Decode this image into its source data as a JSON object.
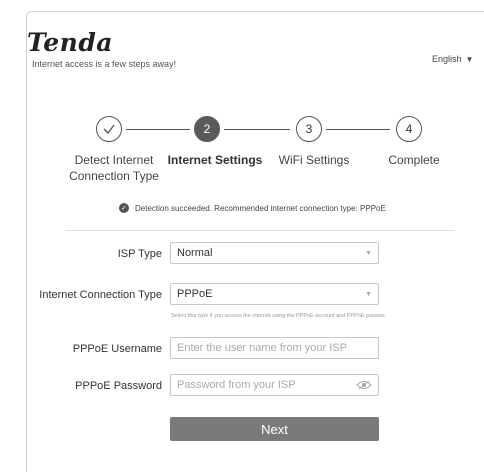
{
  "brand": {
    "logo": "Tenda",
    "tagline": "Internet access is a few steps away!"
  },
  "language": {
    "label": "English"
  },
  "steps": [
    {
      "number": "",
      "label": "Detect Internet Connection Type",
      "state": "done"
    },
    {
      "number": "2",
      "label": "Internet Settings",
      "state": "active"
    },
    {
      "number": "3",
      "label": "WiFi Settings",
      "state": "pending"
    },
    {
      "number": "4",
      "label": "Complete",
      "state": "pending"
    }
  ],
  "status": {
    "text": "Detection succeeded. Recommended internet connection type: PPPoE"
  },
  "form": {
    "isp_type": {
      "label": "ISP Type",
      "value": "Normal"
    },
    "connection_type": {
      "label": "Internet Connection Type",
      "value": "PPPoE",
      "hint": "Select this type if you access the internet using the PPPoE account and PPPoE passwo"
    },
    "username": {
      "label": "PPPoE Username",
      "placeholder": "Enter the user name from your ISP"
    },
    "password": {
      "label": "PPPoE Password",
      "placeholder": "Password from your ISP"
    }
  },
  "next_button": {
    "label": "Next"
  },
  "colors": {
    "accent": "#5a5a5a",
    "button": "#7a7a7a"
  }
}
